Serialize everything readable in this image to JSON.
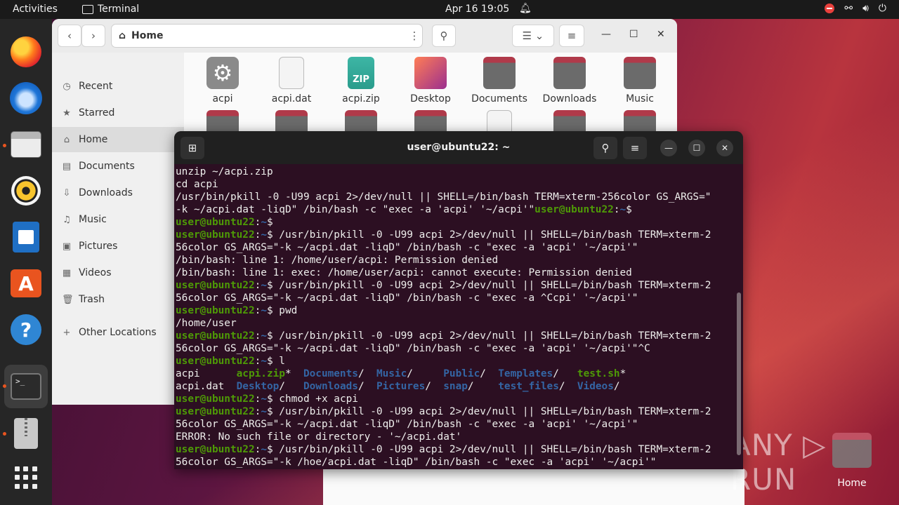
{
  "topbar": {
    "activities": "Activities",
    "app_name": "Terminal",
    "clock": "Apr 16  19:05"
  },
  "dock": {
    "items": [
      "firefox",
      "thunderbird",
      "files",
      "rhythmbox",
      "writer",
      "app-center",
      "help",
      "terminal",
      "archive",
      "show-apps"
    ]
  },
  "files": {
    "path_label": "Home",
    "sidebar": [
      {
        "label": "Recent",
        "icon": "clock-icon"
      },
      {
        "label": "Starred",
        "icon": "star-icon"
      },
      {
        "label": "Home",
        "icon": "home-icon"
      },
      {
        "label": "Documents",
        "icon": "document-icon"
      },
      {
        "label": "Downloads",
        "icon": "download-icon"
      },
      {
        "label": "Music",
        "icon": "music-icon"
      },
      {
        "label": "Pictures",
        "icon": "picture-icon"
      },
      {
        "label": "Videos",
        "icon": "video-icon"
      },
      {
        "label": "Trash",
        "icon": "trash-icon"
      },
      {
        "label": "Other Locations",
        "icon": "plus-icon"
      }
    ],
    "items": [
      {
        "label": "acpi"
      },
      {
        "label": "acpi.dat"
      },
      {
        "label": "acpi.zip"
      },
      {
        "label": "Desktop"
      },
      {
        "label": "Documents"
      },
      {
        "label": "Downloads"
      },
      {
        "label": "Music"
      }
    ],
    "zip_badge": "ZIP"
  },
  "terminal": {
    "title": "user@ubuntu22: ~",
    "lines": [
      "unzip ~/acpi.zip",
      "cd acpi",
      "/usr/bin/pkill -0 -U99 acpi 2>/dev/null || SHELL=/bin/bash TERM=xterm-256color GS_ARGS=\"",
      "-k ~/acpi.dat -liqD\" /bin/bash -c \"exec -a 'acpi' '~/acpi'\"",
      "",
      "$ /usr/bin/pkill -0 -U99 acpi 2>/dev/null || SHELL=/bin/bash TERM=xterm-2",
      "56color GS_ARGS=\"-k ~/acpi.dat -liqD\" /bin/bash -c \"exec -a 'acpi' '~/acpi'\"",
      "/bin/bash: line 1: /home/user/acpi: Permission denied",
      "/bin/bash: line 1: exec: /home/user/acpi: cannot execute: Permission denied",
      "$ /usr/bin/pkill -0 -U99 acpi 2>/dev/null || SHELL=/bin/bash TERM=xterm-2",
      "56color GS_ARGS=\"-k ~/acpi.dat -liqD\" /bin/bash -c \"exec -a ^Ccpi' '~/acpi'\"",
      "$ pwd",
      "/home/user",
      "$ /usr/bin/pkill -0 -U99 acpi 2>/dev/null || SHELL=/bin/bash TERM=xterm-2",
      "56color GS_ARGS=\"-k ~/acpi.dat -liqD\" /bin/bash -c \"exec -a 'acpi' '~/acpi'\"^C",
      "$ l",
      "$ chmod +x acpi",
      "$ /usr/bin/pkill -0 -U99 acpi 2>/dev/null || SHELL=/bin/bash TERM=xterm-2",
      "56color GS_ARGS=\"-k ~/acpi.dat -liqD\" /bin/bash -c \"exec -a 'acpi' '~/acpi'\"",
      "ERROR: No such file or directory - '~/acpi.dat'",
      "$ /usr/bin/pkill -0 -U99 acpi 2>/dev/null || SHELL=/bin/bash TERM=xterm-2",
      "56color GS_ARGS=\"-k /hoe/acpi.dat -liqD\" /bin/bash -c \"exec -a 'acpi' '~/acpi'\""
    ],
    "prompt_user": "user@ubuntu22",
    "prompt_sep": ":",
    "prompt_path": "~",
    "ls_row1": [
      "acpi",
      "acpi.zip",
      "*",
      "Documents",
      "/",
      "Music",
      "/",
      "Public",
      "/",
      "Templates",
      "/",
      "test.sh",
      "*"
    ],
    "ls_row2": [
      "acpi.dat",
      "Desktop",
      "/",
      "Downloads",
      "/",
      "Pictures",
      "/",
      "snap",
      "/",
      "test_files",
      "/",
      "Videos",
      "/"
    ]
  },
  "desktop": {
    "home_label": "Home",
    "watermark": "ANY ▷ RUN"
  },
  "colors": {
    "prompt_green": "#4e9a06",
    "path_blue": "#3465a4",
    "terminal_bg": "#2c0f22"
  }
}
